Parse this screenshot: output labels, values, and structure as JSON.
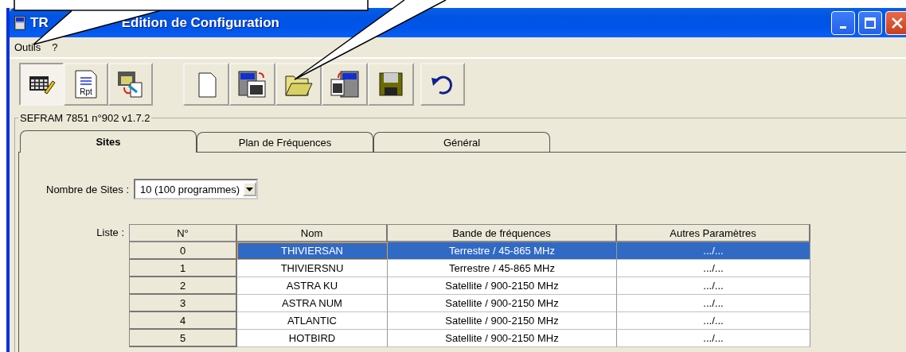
{
  "window": {
    "title_parts": [
      "TR",
      "Edition de Configuration"
    ]
  },
  "menu": [
    {
      "label": "Outils"
    },
    {
      "label": "?"
    }
  ],
  "toolbar": {
    "groups": [
      [
        {
          "pressed": true
        },
        {
          "pressed": false,
          "label": "Rpt"
        },
        {
          "pressed": false
        }
      ],
      [
        {
          "pressed": false
        },
        {
          "pressed": false
        },
        {
          "pressed": false
        },
        {
          "pressed": false
        },
        {
          "pressed": false
        }
      ],
      [
        {
          "pressed": false
        }
      ]
    ]
  },
  "group_title": "SEFRAM 7851 n°902 v1.7.2",
  "tabs": [
    {
      "label": "Sites",
      "selected": true
    },
    {
      "label": "Plan de Fréquences",
      "selected": false
    },
    {
      "label": "Général",
      "selected": false
    }
  ],
  "sites_count": {
    "label": "Nombre de Sites :",
    "value": "10  (100 programmes)"
  },
  "table": {
    "label": "Liste :",
    "columns": [
      "N°",
      "Nom",
      "Bande de fréquences",
      "Autres Paramètres"
    ],
    "rows": [
      {
        "cells": [
          "0",
          "THIVIERSAN",
          "Terrestre / 45-865 MHz",
          ".../..."
        ],
        "selected": true
      },
      {
        "cells": [
          "1",
          "THIVIERSNU",
          "Terrestre / 45-865 MHz",
          ".../..."
        ],
        "selected": false
      },
      {
        "cells": [
          "2",
          "ASTRA KU",
          "Satellite / 900-2150 MHz",
          ".../..."
        ],
        "selected": false
      },
      {
        "cells": [
          "3",
          "ASTRA NUM",
          "Satellite / 900-2150 MHz",
          ".../..."
        ],
        "selected": false
      },
      {
        "cells": [
          "4",
          "ATLANTIC",
          "Satellite / 900-2150 MHz",
          ".../..."
        ],
        "selected": false
      },
      {
        "cells": [
          "5",
          "HOTBIRD",
          "Satellite / 900-2150 MHz",
          ".../..."
        ],
        "selected": false
      }
    ]
  }
}
